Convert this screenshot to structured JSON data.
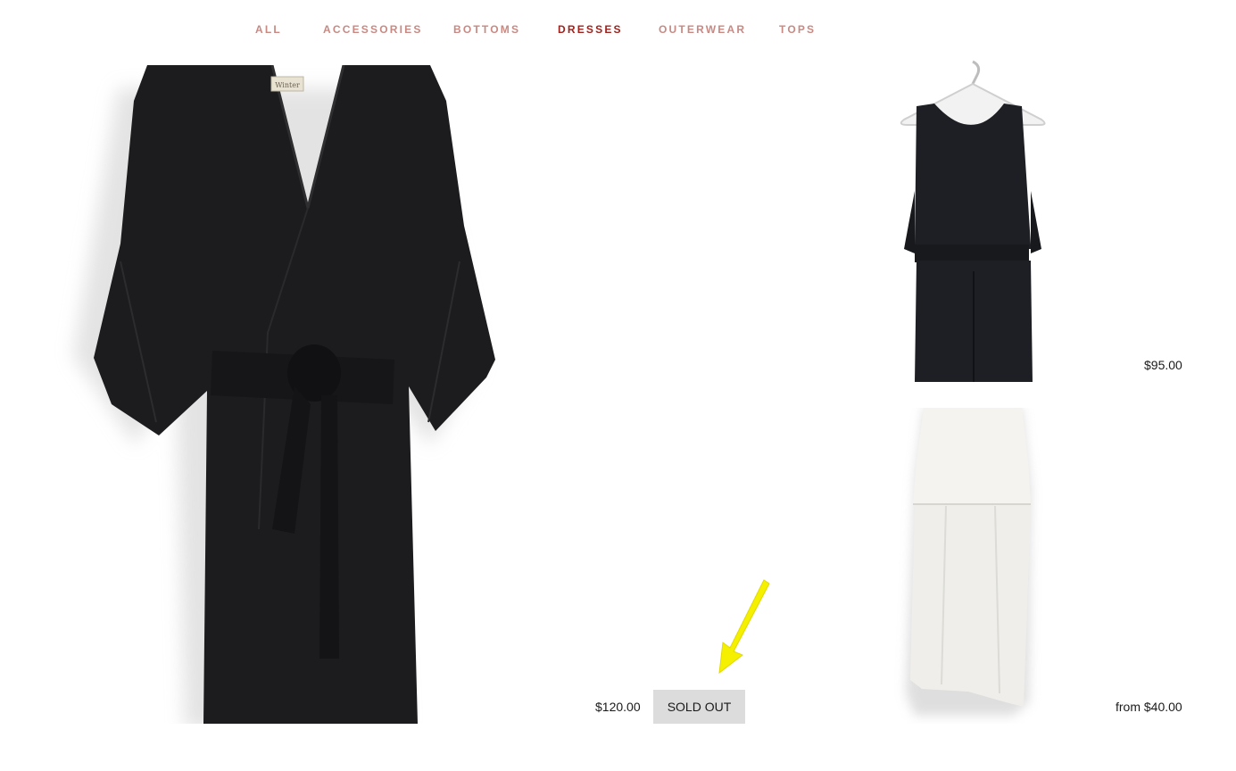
{
  "nav": {
    "items": [
      {
        "label": "ALL",
        "active": false
      },
      {
        "label": "ACCESSORIES",
        "active": false
      },
      {
        "label": "BOTTOMS",
        "active": false
      },
      {
        "label": "DRESSES",
        "active": true
      },
      {
        "label": "OUTERWEAR",
        "active": false
      },
      {
        "label": "TOPS",
        "active": false
      }
    ]
  },
  "products": [
    {
      "name": "black wrap dress",
      "price": "$120.00",
      "badge": "SOLD OUT"
    },
    {
      "name": "black jumpsuit",
      "price": "$95.00"
    },
    {
      "name": "white dress",
      "price": "from $40.00"
    }
  ],
  "colors": {
    "nav_text": "#c98983",
    "nav_active": "#a0221c",
    "badge_bg": "#dcdcdc",
    "annotation_arrow": "#f5f000"
  }
}
